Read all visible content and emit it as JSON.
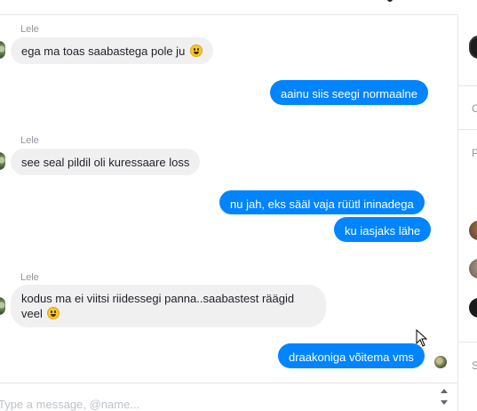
{
  "messages": [
    {
      "sender": "Lele",
      "text": "ega ma toas saabastega pole ju",
      "emoji": "grinning-emoji"
    },
    {
      "text": "aainu siis seegi normaalne"
    },
    {
      "sender": "Lele",
      "text": "see seal pildil oli kuressaare loss"
    },
    {
      "text": "nu jah, eks sääl vaja rüütl ininadega"
    },
    {
      "text": "ku iasjaks lähe"
    },
    {
      "sender": "Lele",
      "text": "kodus ma ei viitsi riidessegi panna..saabastest räägid veel",
      "emoji": "grinning-emoji"
    },
    {
      "text": "draakoniga võitema vms"
    }
  ],
  "composer": {
    "placeholder": "Type a message, @name..."
  },
  "right_panel": {
    "letters": [
      "C",
      "P",
      "S"
    ]
  },
  "colors": {
    "outgoing": "#0084ff",
    "incoming": "#f1f0f0",
    "text": "#1d2129"
  }
}
